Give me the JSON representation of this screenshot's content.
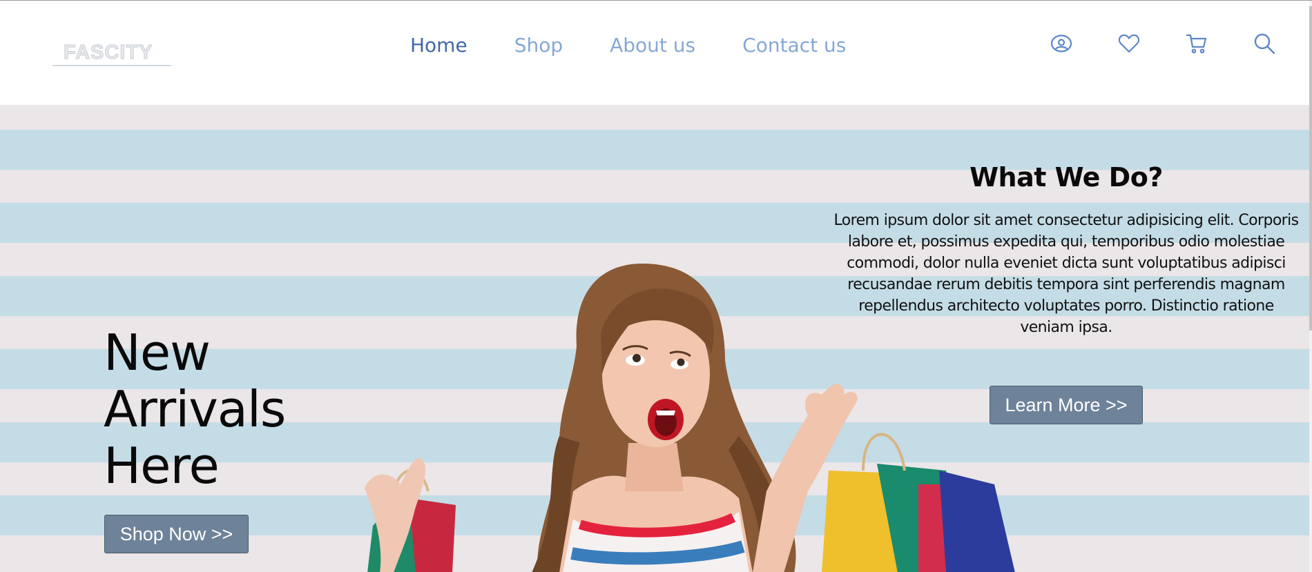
{
  "brand": {
    "logo_text": "FASCITY"
  },
  "nav": {
    "items": [
      {
        "label": "Home",
        "active": true
      },
      {
        "label": "Shop"
      },
      {
        "label": "About us"
      },
      {
        "label": "Contact us"
      }
    ]
  },
  "header_icons": [
    "user-icon",
    "heart-icon",
    "cart-icon",
    "search-icon"
  ],
  "hero": {
    "title": "New Arrivals Here",
    "shop_button": "Shop Now >>",
    "info_title": "What We Do?",
    "info_text": "Lorem ipsum dolor sit amet consectetur adipisicing elit. Corporis labore et, possimus expedita qui, temporibus odio molestiae commodi, dolor nulla eveniet dicta sunt voluptatibus adipisci recusandae rerum debitis tempora sint perferendis magnam repellendus architecto voluptates porro. Distinctio ratione veniam ipsa.",
    "learn_button": "Learn More >>"
  },
  "colors": {
    "nav_active": "#3f67a7",
    "nav": "#86a7d6",
    "button": "#6e8299",
    "stripe_light": "#ebe6e8",
    "stripe_blue": "#c4dce6"
  }
}
